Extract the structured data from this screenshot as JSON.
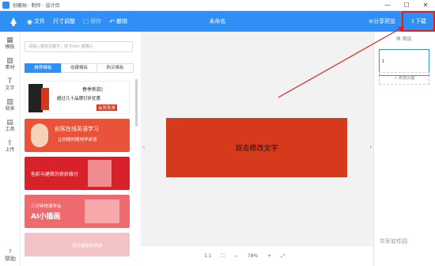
{
  "titlebar": {
    "title": "创客贴 · 制作 · 设计页",
    "minimize": "—",
    "maximize": "☐",
    "close": "✕"
  },
  "toolbar": {
    "file_label": "文件",
    "size_label": "尺寸调整",
    "save_label": "保存",
    "undo_label": "撤销",
    "doc_title": "未命名",
    "share_label": "分享预览",
    "download_label": "下载"
  },
  "leftnav": {
    "items": [
      {
        "icon": "template-icon",
        "label": "模板"
      },
      {
        "icon": "material-icon",
        "label": "素材"
      },
      {
        "icon": "text-icon",
        "label": "文字"
      },
      {
        "icon": "background-icon",
        "label": "背景"
      },
      {
        "icon": "tools-icon",
        "label": "工具"
      },
      {
        "icon": "upload-icon",
        "label": "上传"
      }
    ],
    "help_label": "帮助"
  },
  "panel": {
    "search_placeholder": "请输入模板关键字，按 Enter 键确认",
    "tabs": [
      "推荐模板",
      "收藏模板",
      "购买模板"
    ],
    "active_tab": 0,
    "templates": [
      {
        "line1": "春季新款|",
        "line2": "超过几十品牌打折优惠",
        "line3": "会员免单",
        "bg": "#ffffff",
        "accent": "#d6371f"
      },
      {
        "line1": "创客在线英语学习",
        "line2": "让你随时随地学英语",
        "bg": "#e9533a",
        "accent": "#ffffff"
      },
      {
        "line1": "色彩与建筑的奇妙缘分",
        "line2": "",
        "bg": "#d8222b",
        "accent": "#ffffff"
      },
      {
        "line1": "三分钟快速学会",
        "line2": "AI小插画",
        "bg": "#ee6a6f",
        "accent": "#ffffff"
      },
      {
        "line1": "适合摄影和旅游",
        "line2": "",
        "bg": "#f3c3c6",
        "accent": "#ffffff"
      }
    ]
  },
  "canvas": {
    "card_text": "双击修改文字",
    "card_color": "#d63a1c"
  },
  "bottombar": {
    "ratio_label": "1:1",
    "fit_icon": "fit-screen-icon",
    "zoom_out": "−",
    "zoom_value": "78%",
    "zoom_in": "+",
    "fullscreen_icon": "fullscreen-icon"
  },
  "rightpanel": {
    "layers_label": "图层",
    "page_number": "1",
    "add_page_label": "＋ 新增页面"
  },
  "watermark": "华军软件园",
  "colors": {
    "primary": "#2f8ff4",
    "highlight": "#e02020"
  }
}
